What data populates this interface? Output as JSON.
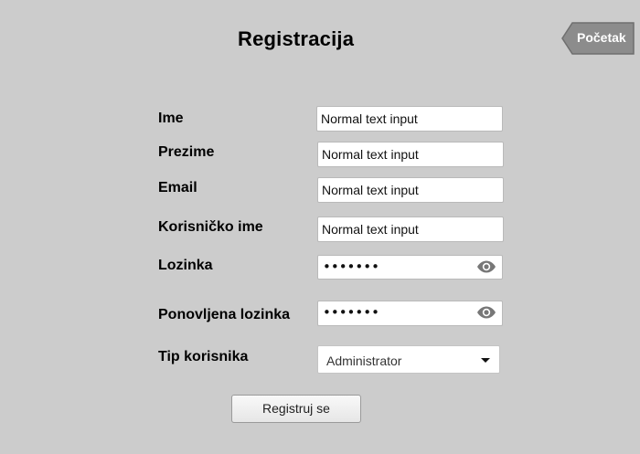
{
  "page": {
    "title": "Registracija",
    "back_label": "Početak"
  },
  "form": {
    "first_name": {
      "label": "Ime",
      "value": "Normal text input"
    },
    "last_name": {
      "label": "Prezime",
      "value": "Normal text input"
    },
    "email": {
      "label": "Email",
      "value": "Normal text input"
    },
    "username": {
      "label": "Korisničko ime",
      "value": "Normal text input"
    },
    "password": {
      "label": "Lozinka",
      "masked_value": "•••••••"
    },
    "password_repeat": {
      "label": "Ponovljena lozinka",
      "masked_value": "•••••••"
    },
    "user_type": {
      "label": "Tip korisnika",
      "selected": "Administrator"
    },
    "submit_label": "Registruj se"
  },
  "icons": {
    "show_password": "eye-icon",
    "dropdown": "chevron-down-icon",
    "back": "back-arrow-button"
  },
  "colors": {
    "background": "#cccccc",
    "back_button": "#8c8c8c",
    "input_background": "#ffffff",
    "icon": "#777777"
  }
}
